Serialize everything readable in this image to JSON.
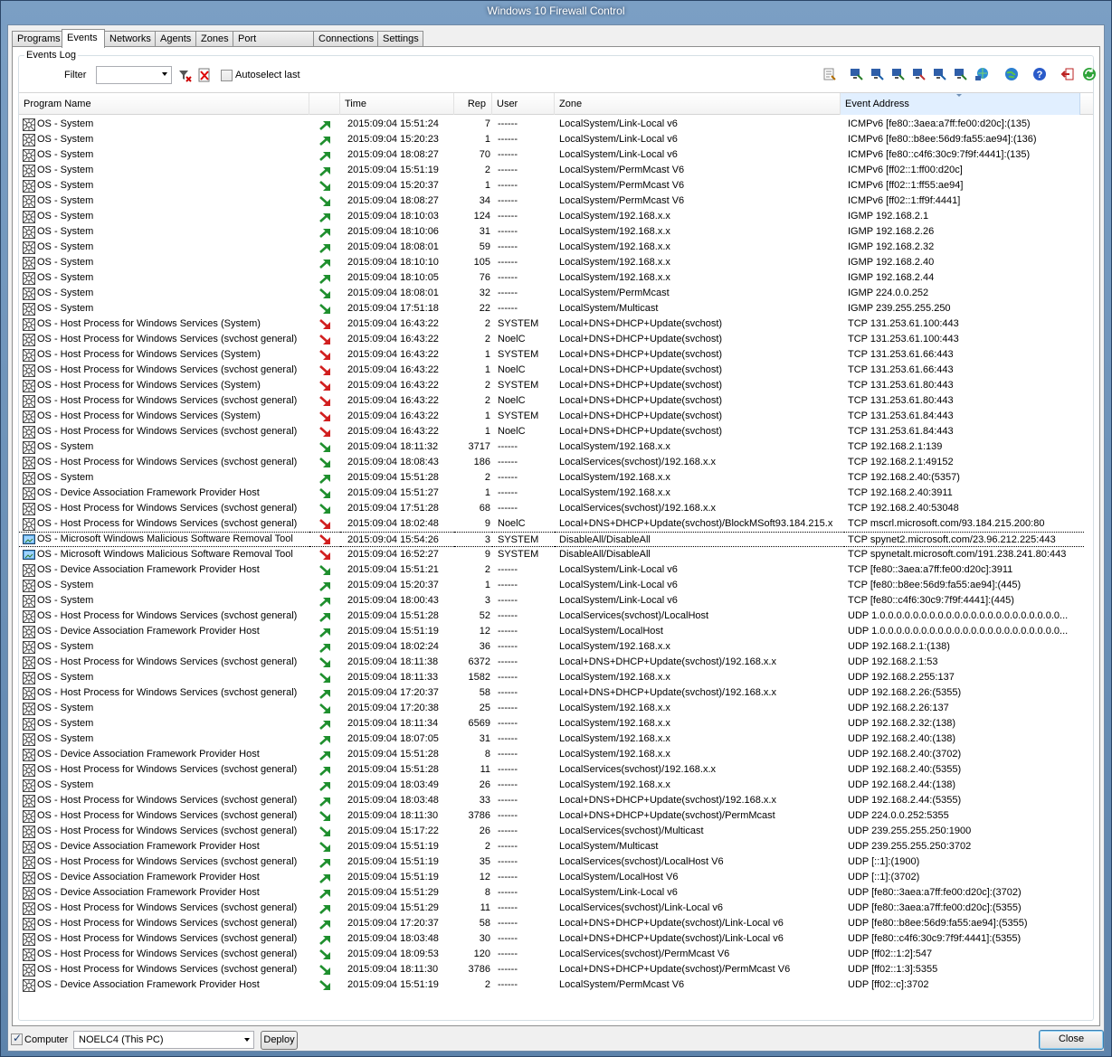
{
  "window": {
    "title": "Windows 10 Firewall Control"
  },
  "tabs": [
    {
      "label": "Programs",
      "w": 56
    },
    {
      "label": "Events",
      "w": 48
    },
    {
      "label": "Networks",
      "w": 57
    },
    {
      "label": "Agents",
      "w": 46
    },
    {
      "label": "Zones",
      "w": 42
    },
    {
      "label": "Port Forwarding",
      "w": 90
    },
    {
      "label": "Connections",
      "w": 72
    },
    {
      "label": "Settings",
      "w": 51
    }
  ],
  "active_tab": "Events",
  "events_log": {
    "legend": "Events Log",
    "filter_label": "Filter",
    "filter_value": "",
    "autoselect_label": "Autoselect last",
    "autoselect_checked": false
  },
  "columns": {
    "program": "Program Name",
    "dir": "",
    "time": "Time",
    "rep": "Rep",
    "user": "User",
    "zone": "Zone",
    "address": "Event Address"
  },
  "rows": [
    [
      "sys",
      "OS - System",
      "in",
      "2015:09:04 15:51:24",
      "7",
      "------",
      "LocalSystem/Link-Local v6",
      "ICMPv6 [fe80::3aea:a7ff:fe00:d20c]:(135)"
    ],
    [
      "sys",
      "OS - System",
      "in",
      "2015:09:04 15:20:23",
      "1",
      "------",
      "LocalSystem/Link-Local v6",
      "ICMPv6 [fe80::b8ee:56d9:fa55:ae94]:(136)"
    ],
    [
      "sys",
      "OS - System",
      "in",
      "2015:09:04 18:08:27",
      "70",
      "------",
      "LocalSystem/Link-Local v6",
      "ICMPv6 [fe80::c4f6:30c9:7f9f:4441]:(135)"
    ],
    [
      "sys",
      "OS - System",
      "in",
      "2015:09:04 15:51:19",
      "2",
      "------",
      "LocalSystem/PermMcast V6",
      "ICMPv6 [ff02::1:ff00:d20c]"
    ],
    [
      "sys",
      "OS - System",
      "out",
      "2015:09:04 15:20:37",
      "1",
      "------",
      "LocalSystem/PermMcast V6",
      "ICMPv6 [ff02::1:ff55:ae94]"
    ],
    [
      "sys",
      "OS - System",
      "out",
      "2015:09:04 18:08:27",
      "34",
      "------",
      "LocalSystem/PermMcast V6",
      "ICMPv6 [ff02::1:ff9f:4441]"
    ],
    [
      "sys",
      "OS - System",
      "in",
      "2015:09:04 18:10:03",
      "124",
      "------",
      "LocalSystem/192.168.x.x",
      "IGMP 192.168.2.1"
    ],
    [
      "sys",
      "OS - System",
      "in",
      "2015:09:04 18:10:06",
      "31",
      "------",
      "LocalSystem/192.168.x.x",
      "IGMP 192.168.2.26"
    ],
    [
      "sys",
      "OS - System",
      "in",
      "2015:09:04 18:08:01",
      "59",
      "------",
      "LocalSystem/192.168.x.x",
      "IGMP 192.168.2.32"
    ],
    [
      "sys",
      "OS - System",
      "in",
      "2015:09:04 18:10:10",
      "105",
      "------",
      "LocalSystem/192.168.x.x",
      "IGMP 192.168.2.40"
    ],
    [
      "sys",
      "OS - System",
      "in",
      "2015:09:04 18:10:05",
      "76",
      "------",
      "LocalSystem/192.168.x.x",
      "IGMP 192.168.2.44"
    ],
    [
      "sys",
      "OS - System",
      "out",
      "2015:09:04 18:08:01",
      "32",
      "------",
      "LocalSystem/PermMcast",
      "IGMP 224.0.0.252"
    ],
    [
      "sys",
      "OS - System",
      "out",
      "2015:09:04 17:51:18",
      "22",
      "------",
      "LocalSystem/Multicast",
      "IGMP 239.255.255.250"
    ],
    [
      "sys",
      "OS - Host Process for Windows Services (System)",
      "block",
      "2015:09:04 16:43:22",
      "2",
      "SYSTEM",
      "Local+DNS+DHCP+Update(svchost)",
      "TCP 131.253.61.100:443"
    ],
    [
      "sys",
      "OS - Host Process for Windows Services (svchost general)",
      "block",
      "2015:09:04 16:43:22",
      "2",
      "NoelC",
      "Local+DNS+DHCP+Update(svchost)",
      "TCP 131.253.61.100:443"
    ],
    [
      "sys",
      "OS - Host Process for Windows Services (System)",
      "block",
      "2015:09:04 16:43:22",
      "1",
      "SYSTEM",
      "Local+DNS+DHCP+Update(svchost)",
      "TCP 131.253.61.66:443"
    ],
    [
      "sys",
      "OS - Host Process for Windows Services (svchost general)",
      "block",
      "2015:09:04 16:43:22",
      "1",
      "NoelC",
      "Local+DNS+DHCP+Update(svchost)",
      "TCP 131.253.61.66:443"
    ],
    [
      "sys",
      "OS - Host Process for Windows Services (System)",
      "block",
      "2015:09:04 16:43:22",
      "2",
      "SYSTEM",
      "Local+DNS+DHCP+Update(svchost)",
      "TCP 131.253.61.80:443"
    ],
    [
      "sys",
      "OS - Host Process for Windows Services (svchost general)",
      "block",
      "2015:09:04 16:43:22",
      "2",
      "NoelC",
      "Local+DNS+DHCP+Update(svchost)",
      "TCP 131.253.61.80:443"
    ],
    [
      "sys",
      "OS - Host Process for Windows Services (System)",
      "block",
      "2015:09:04 16:43:22",
      "1",
      "SYSTEM",
      "Local+DNS+DHCP+Update(svchost)",
      "TCP 131.253.61.84:443"
    ],
    [
      "sys",
      "OS - Host Process for Windows Services (svchost general)",
      "block",
      "2015:09:04 16:43:22",
      "1",
      "NoelC",
      "Local+DNS+DHCP+Update(svchost)",
      "TCP 131.253.61.84:443"
    ],
    [
      "sys",
      "OS - System",
      "out",
      "2015:09:04 18:11:32",
      "3717",
      "------",
      "LocalSystem/192.168.x.x",
      "TCP 192.168.2.1:139"
    ],
    [
      "sys",
      "OS - Host Process for Windows Services (svchost general)",
      "out",
      "2015:09:04 18:08:43",
      "186",
      "------",
      "LocalServices(svchost)/192.168.x.x",
      "TCP 192.168.2.1:49152"
    ],
    [
      "sys",
      "OS - System",
      "in",
      "2015:09:04 15:51:28",
      "2",
      "------",
      "LocalSystem/192.168.x.x",
      "TCP 192.168.2.40:(5357)"
    ],
    [
      "sys",
      "OS - Device Association Framework Provider Host",
      "out",
      "2015:09:04 15:51:27",
      "1",
      "------",
      "LocalSystem/192.168.x.x",
      "TCP 192.168.2.40:3911"
    ],
    [
      "sys",
      "OS - Host Process for Windows Services (svchost general)",
      "out",
      "2015:09:04 17:51:28",
      "68",
      "------",
      "LocalServices(svchost)/192.168.x.x",
      "TCP 192.168.2.40:53048"
    ],
    [
      "sys",
      "OS - Host Process for Windows Services (svchost general)",
      "block",
      "2015:09:04 18:02:48",
      "9",
      "NoelC",
      "Local+DNS+DHCP+Update(svchost)/BlockMSoft93.184.215.x",
      "TCP mscrl.microsoft.com/93.184.215.200:80"
    ],
    [
      "mrt",
      "OS - Microsoft Windows Malicious Software Removal Tool",
      "block",
      "2015:09:04 15:54:26",
      "3",
      "SYSTEM",
      "DisableAll/DisableAll",
      "TCP spynet2.microsoft.com/23.96.212.225:443"
    ],
    [
      "mrt",
      "OS - Microsoft Windows Malicious Software Removal Tool",
      "block",
      "2015:09:04 16:52:27",
      "9",
      "SYSTEM",
      "DisableAll/DisableAll",
      "TCP spynetalt.microsoft.com/191.238.241.80:443"
    ],
    [
      "sys",
      "OS - Device Association Framework Provider Host",
      "out",
      "2015:09:04 15:51:21",
      "2",
      "------",
      "LocalSystem/Link-Local v6",
      "TCP [fe80::3aea:a7ff:fe00:d20c]:3911"
    ],
    [
      "sys",
      "OS - System",
      "in",
      "2015:09:04 15:20:37",
      "1",
      "------",
      "LocalSystem/Link-Local v6",
      "TCP [fe80::b8ee:56d9:fa55:ae94]:(445)"
    ],
    [
      "sys",
      "OS - System",
      "in",
      "2015:09:04 18:00:43",
      "3",
      "------",
      "LocalSystem/Link-Local v6",
      "TCP [fe80::c4f6:30c9:7f9f:4441]:(445)"
    ],
    [
      "sys",
      "OS - Host Process for Windows Services (svchost general)",
      "in",
      "2015:09:04 15:51:28",
      "52",
      "------",
      "LocalServices(svchost)/LocalHost",
      "UDP 1.0.0.0.0.0.0.0.0.0.0.0.0.0.0.0.0.0.0.0.0.0.0..."
    ],
    [
      "sys",
      "OS - Device Association Framework Provider Host",
      "in",
      "2015:09:04 15:51:19",
      "12",
      "------",
      "LocalSystem/LocalHost",
      "UDP 1.0.0.0.0.0.0.0.0.0.0.0.0.0.0.0.0.0.0.0.0.0.0..."
    ],
    [
      "sys",
      "OS - System",
      "in",
      "2015:09:04 18:02:24",
      "36",
      "------",
      "LocalSystem/192.168.x.x",
      "UDP 192.168.2.1:(138)"
    ],
    [
      "sys",
      "OS - Host Process for Windows Services (svchost general)",
      "out",
      "2015:09:04 18:11:38",
      "6372",
      "------",
      "Local+DNS+DHCP+Update(svchost)/192.168.x.x",
      "UDP 192.168.2.1:53"
    ],
    [
      "sys",
      "OS - System",
      "out",
      "2015:09:04 18:11:33",
      "1582",
      "------",
      "LocalSystem/192.168.x.x",
      "UDP 192.168.2.255:137"
    ],
    [
      "sys",
      "OS - Host Process for Windows Services (svchost general)",
      "in",
      "2015:09:04 17:20:37",
      "58",
      "------",
      "Local+DNS+DHCP+Update(svchost)/192.168.x.x",
      "UDP 192.168.2.26:(5355)"
    ],
    [
      "sys",
      "OS - System",
      "out",
      "2015:09:04 17:20:38",
      "25",
      "------",
      "LocalSystem/192.168.x.x",
      "UDP 192.168.2.26:137"
    ],
    [
      "sys",
      "OS - System",
      "in",
      "2015:09:04 18:11:34",
      "6569",
      "------",
      "LocalSystem/192.168.x.x",
      "UDP 192.168.2.32:(138)"
    ],
    [
      "sys",
      "OS - System",
      "in",
      "2015:09:04 18:07:05",
      "31",
      "------",
      "LocalSystem/192.168.x.x",
      "UDP 192.168.2.40:(138)"
    ],
    [
      "sys",
      "OS - Device Association Framework Provider Host",
      "in",
      "2015:09:04 15:51:28",
      "8",
      "------",
      "LocalSystem/192.168.x.x",
      "UDP 192.168.2.40:(3702)"
    ],
    [
      "sys",
      "OS - Host Process for Windows Services (svchost general)",
      "in",
      "2015:09:04 15:51:28",
      "11",
      "------",
      "LocalServices(svchost)/192.168.x.x",
      "UDP 192.168.2.40:(5355)"
    ],
    [
      "sys",
      "OS - System",
      "in",
      "2015:09:04 18:03:49",
      "26",
      "------",
      "LocalSystem/192.168.x.x",
      "UDP 192.168.2.44:(138)"
    ],
    [
      "sys",
      "OS - Host Process for Windows Services (svchost general)",
      "in",
      "2015:09:04 18:03:48",
      "33",
      "------",
      "Local+DNS+DHCP+Update(svchost)/192.168.x.x",
      "UDP 192.168.2.44:(5355)"
    ],
    [
      "sys",
      "OS - Host Process for Windows Services (svchost general)",
      "out",
      "2015:09:04 18:11:30",
      "3786",
      "------",
      "Local+DNS+DHCP+Update(svchost)/PermMcast",
      "UDP 224.0.0.252:5355"
    ],
    [
      "sys",
      "OS - Host Process for Windows Services (svchost general)",
      "out",
      "2015:09:04 15:17:22",
      "26",
      "------",
      "LocalServices(svchost)/Multicast",
      "UDP 239.255.255.250:1900"
    ],
    [
      "sys",
      "OS - Device Association Framework Provider Host",
      "out",
      "2015:09:04 15:51:19",
      "2",
      "------",
      "LocalSystem/Multicast",
      "UDP 239.255.255.250:3702"
    ],
    [
      "sys",
      "OS - Host Process for Windows Services (svchost general)",
      "in",
      "2015:09:04 15:51:19",
      "35",
      "------",
      "LocalServices(svchost)/LocalHost V6",
      "UDP [::1]:(1900)"
    ],
    [
      "sys",
      "OS - Device Association Framework Provider Host",
      "in",
      "2015:09:04 15:51:19",
      "12",
      "------",
      "LocalSystem/LocalHost V6",
      "UDP [::1]:(3702)"
    ],
    [
      "sys",
      "OS - Device Association Framework Provider Host",
      "in",
      "2015:09:04 15:51:29",
      "8",
      "------",
      "LocalSystem/Link-Local v6",
      "UDP [fe80::3aea:a7ff:fe00:d20c]:(3702)"
    ],
    [
      "sys",
      "OS - Host Process for Windows Services (svchost general)",
      "in",
      "2015:09:04 15:51:29",
      "11",
      "------",
      "LocalServices(svchost)/Link-Local v6",
      "UDP [fe80::3aea:a7ff:fe00:d20c]:(5355)"
    ],
    [
      "sys",
      "OS - Host Process for Windows Services (svchost general)",
      "in",
      "2015:09:04 17:20:37",
      "58",
      "------",
      "Local+DNS+DHCP+Update(svchost)/Link-Local v6",
      "UDP [fe80::b8ee:56d9:fa55:ae94]:(5355)"
    ],
    [
      "sys",
      "OS - Host Process for Windows Services (svchost general)",
      "in",
      "2015:09:04 18:03:48",
      "30",
      "------",
      "Local+DNS+DHCP+Update(svchost)/Link-Local v6",
      "UDP [fe80::c4f6:30c9:7f9f:4441]:(5355)"
    ],
    [
      "sys",
      "OS - Host Process for Windows Services (svchost general)",
      "out",
      "2015:09:04 18:09:53",
      "120",
      "------",
      "LocalServices(svchost)/PermMcast V6",
      "UDP [ff02::1:2]:547"
    ],
    [
      "sys",
      "OS - Host Process for Windows Services (svchost general)",
      "out",
      "2015:09:04 18:11:30",
      "3786",
      "------",
      "Local+DNS+DHCP+Update(svchost)/PermMcast V6",
      "UDP [ff02::1:3]:5355"
    ],
    [
      "sys",
      "OS - Device Association Framework Provider Host",
      "out",
      "2015:09:04 15:51:19",
      "2",
      "------",
      "LocalSystem/PermMcast V6",
      "UDP [ff02::c]:3702"
    ]
  ],
  "selected_row": 27,
  "bottom": {
    "computer_label": "Computer",
    "computer_checked": true,
    "computer_value": "NOELC4 (This PC)",
    "deploy_label": "Deploy",
    "close_label": "Close"
  },
  "icons": {
    "filter_toolbar": [
      "filter-apply-icon",
      "filter-clear-icon"
    ],
    "right_toolbar": [
      "export-log-icon",
      "network-icon-1",
      "network-icon-2",
      "network-icon-3",
      "network-icon-4",
      "network-icon-5",
      "network-icon-6",
      "network-globe-icon",
      "globe-icon",
      "help-icon",
      "exit-icon",
      "refresh-icon"
    ]
  },
  "colors": {
    "arrow_in": "#1f8f2e",
    "arrow_block": "#d11f1f",
    "selection_border": "#000000"
  }
}
